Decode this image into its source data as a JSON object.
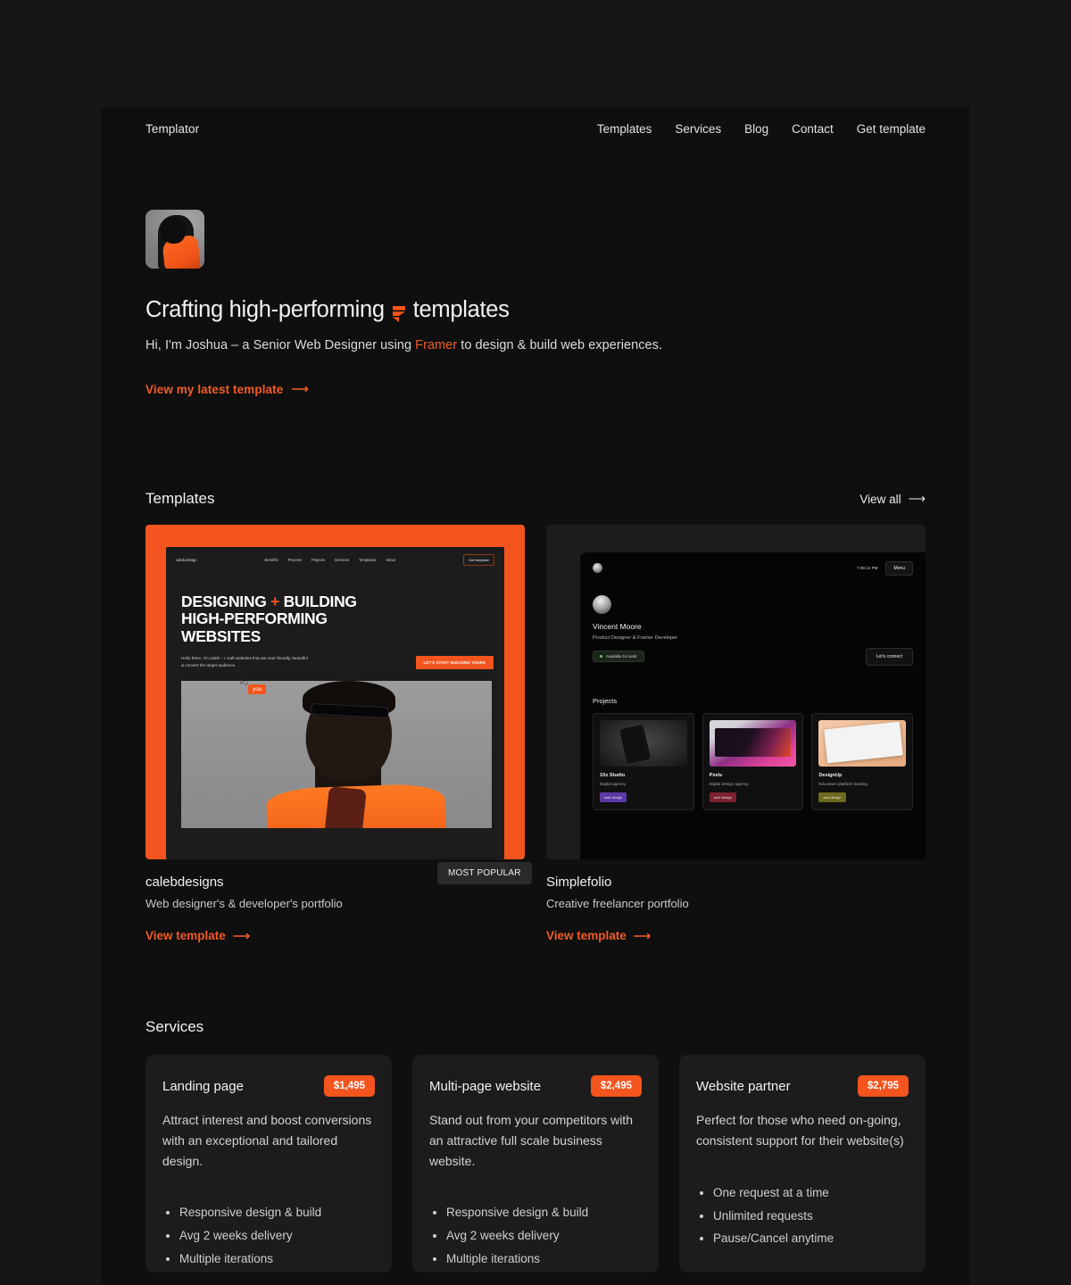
{
  "theme": {
    "accent": "#f25c26",
    "accent_solid": "#f4541d",
    "page_bg": "#0f0f0f",
    "backdrop_bg": "#161616",
    "card_bg": "#1c1c1c"
  },
  "header": {
    "brand": "Templator",
    "nav": [
      {
        "label": "Templates"
      },
      {
        "label": "Services"
      },
      {
        "label": "Blog"
      },
      {
        "label": "Contact"
      },
      {
        "label": "Get template"
      }
    ]
  },
  "hero": {
    "avatar_alt": "portrait-photo",
    "title_before": "Crafting high-performing",
    "title_after": "templates",
    "logo_icon": "framer-icon",
    "subtitle_before": "Hi, I'm Joshua – a Senior Web Designer using ",
    "subtitle_accent": "Framer",
    "subtitle_after": " to design & build web experiences.",
    "cta_label": "View my latest template",
    "cta_arrow": "⟶"
  },
  "templates_section": {
    "title": "Templates",
    "view_all_label": "View all",
    "view_all_arrow": "⟶",
    "most_popular_badge": "MOST POPULAR",
    "cards": [
      {
        "name": "calebdesigns",
        "description": "Web designer's & developer's portfolio",
        "link_label": "View template",
        "link_arrow": "⟶",
        "preview": {
          "logo": "caleb.design",
          "nav": [
            "Benefits",
            "Process",
            "Projects",
            "Services",
            "Templates",
            "About"
          ],
          "nav_button": "Get template",
          "headline_line1_a": "DESIGNING",
          "headline_plus": "+",
          "headline_line1_b": "BUILDING",
          "headline_line2": "HIGH-PERFORMING",
          "headline_line3": "WEBSITES",
          "body_line1": "Hello there, I'm caleb – I craft websites that are user-friendly, beautiful",
          "body_line2": "& convert the target audience.",
          "cta": "LET'S START BUILDING YOURS",
          "cursor_label": "you"
        }
      },
      {
        "name": "Simplefolio",
        "description": "Creative freelancer portfolio",
        "link_label": "View template",
        "link_arrow": "⟶",
        "preview": {
          "time": "7:39:14 PM",
          "menu_label": "Menu",
          "person_name": "Vincent Moore",
          "person_role": "Product Designer & Framer Developer",
          "availability": "Available for work",
          "connect_label": "Let's connect",
          "projects_label": "Projects",
          "projects": [
            {
              "name": "10x Studio",
              "desc": "Digital agency.",
              "tag": "web design",
              "tag_color": "#5b3aa8"
            },
            {
              "name": "Pxels",
              "desc": "Digital design agency.",
              "tag": "web design",
              "tag_color": "#7d2230"
            },
            {
              "name": "DesignUp",
              "desc": "Education platform landing.",
              "tag": "web design",
              "tag_color": "#6d6a1e"
            }
          ]
        }
      }
    ]
  },
  "services_section": {
    "title": "Services",
    "cards": [
      {
        "name": "Landing page",
        "price": "$1,495",
        "description": "Attract interest and boost conversions with an exceptional and tailored design.",
        "features": [
          "Responsive design & build",
          "Avg 2 weeks delivery",
          "Multiple iterations"
        ]
      },
      {
        "name": "Multi-page website",
        "price": "$2,495",
        "description": "Stand out from your competitors with an attractive full scale business website.",
        "features": [
          "Responsive design & build",
          "Avg 2 weeks delivery",
          "Multiple iterations"
        ]
      },
      {
        "name": "Website partner",
        "price": "$2,795",
        "description": "Perfect for those who need on-going, consistent support for their website(s)",
        "features": [
          "One request at a time",
          "Unlimited requests",
          "Pause/Cancel anytime"
        ]
      }
    ]
  }
}
